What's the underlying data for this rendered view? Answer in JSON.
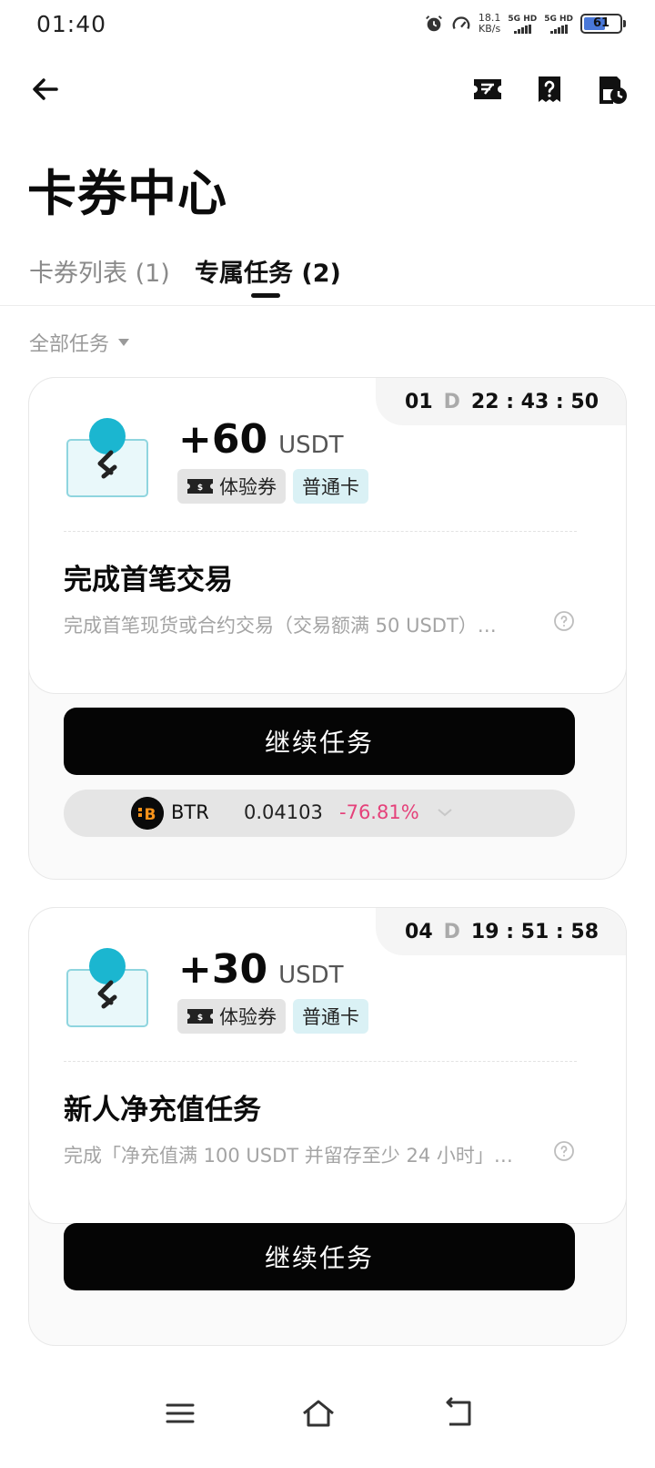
{
  "status": {
    "time": "01:40",
    "net_speed_value": "18.1",
    "net_speed_unit": "KB/s",
    "sim1": "5G HD",
    "sim2": "5G HD",
    "battery": "61",
    "battery_level": 0.61
  },
  "header": {
    "title": "卡券中心"
  },
  "tabs": [
    {
      "label": "卡券列表 (1)"
    },
    {
      "label": "专属任务 (2)"
    }
  ],
  "filter": {
    "label": "全部任务"
  },
  "tasks": [
    {
      "countdown_days": "01",
      "countdown_d": "D",
      "countdown_time": "22 : 43 : 50",
      "amount": "+60",
      "unit": "USDT",
      "tag_experience": "体验券",
      "tag_card": "普通卡",
      "title": "完成首笔交易",
      "description": "完成首笔现货或合约交易（交易额满 50 USDT）…",
      "cta": "继续任务"
    },
    {
      "countdown_days": "04",
      "countdown_d": "D",
      "countdown_time": "19 : 51 : 58",
      "amount": "+30",
      "unit": "USDT",
      "tag_experience": "体验券",
      "tag_card": "普通卡",
      "title": "新人净充值任务",
      "description": "完成「净充值满 100 USDT 并留存至少 24 小时」…",
      "cta": "继续任务"
    }
  ],
  "ticker": {
    "symbol": "BTR",
    "price": "0.04103",
    "change": "-76.81%"
  },
  "colors": {
    "accent_cyan": "#1bb6d0",
    "negative": "#e5417a",
    "battery": "#4a78d8"
  },
  "icons": {
    "back": "arrow-left-icon",
    "coupon": "ticket-icon",
    "help": "help-icon",
    "history": "history-icon"
  }
}
